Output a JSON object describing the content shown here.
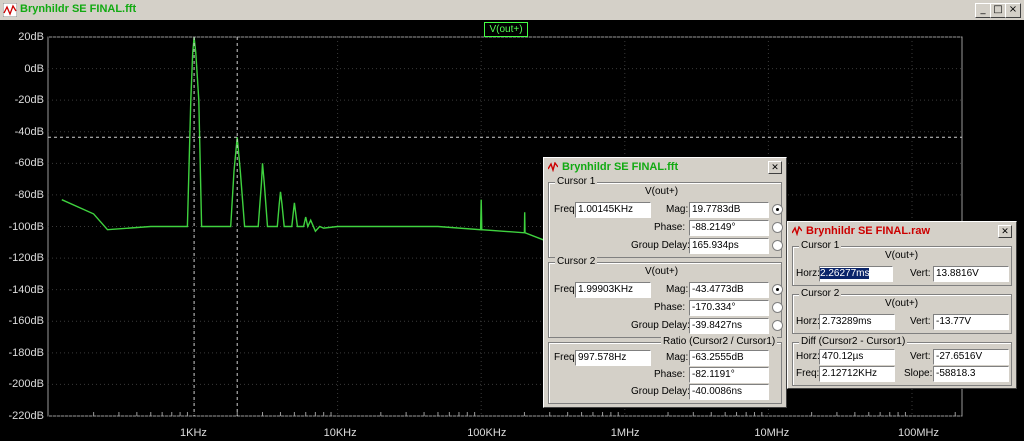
{
  "window": {
    "title": "Brynhildr SE FINAL.fft",
    "minimize": "_",
    "maximize": "□",
    "close": "×"
  },
  "trace_label": "V(out+)",
  "colors": {
    "trace": "#3fd23f",
    "grid": "#e0e0e0",
    "plot_bg": "#000000",
    "dialog_title_red": "#cc0000"
  },
  "chart_data": {
    "type": "line",
    "title": "",
    "xlabel": "",
    "ylabel": "",
    "x_scale": "log",
    "xlim": [
      100,
      300000
    ],
    "ylim": [
      -220,
      20
    ],
    "grid": "dotted",
    "y_ticks": [
      "20dB",
      "0dB",
      "-20dB",
      "-40dB",
      "-60dB",
      "-80dB",
      "-100dB",
      "-120dB",
      "-140dB",
      "-160dB",
      "-180dB",
      "-200dB",
      "-220dB"
    ],
    "x_ticks": [
      "1KHz",
      "10KHz",
      "100KHz",
      "1MHz",
      "10MHz",
      "100MHz"
    ],
    "series": [
      {
        "name": "V(out+)",
        "x": [
          120,
          200,
          250,
          500,
          900,
          950,
          980,
          1001,
          1030,
          1080,
          1130,
          1800,
          1900,
          2000,
          2100,
          2250,
          2800,
          2950,
          3000,
          3080,
          3250,
          3800,
          3920,
          4000,
          4100,
          4250,
          4800,
          4930,
          5000,
          5080,
          5250,
          5800,
          6000,
          6200,
          6500,
          7000,
          7500,
          8000,
          10000,
          20000,
          50000,
          99000,
          100000,
          101000,
          200000,
          201000,
          202000,
          300000
        ],
        "y": [
          -83,
          -92,
          -102,
          -100,
          -100,
          -20,
          10,
          19.78,
          10,
          -20,
          -100,
          -100,
          -65,
          -43.48,
          -65,
          -100,
          -100,
          -72,
          -60,
          -72,
          -100,
          -100,
          -86,
          -78,
          -86,
          -100,
          -100,
          -90,
          -85,
          -90,
          -100,
          -100,
          -94,
          -100,
          -96,
          -103,
          -100,
          -101,
          -100,
          -100,
          -100,
          -102,
          -83,
          -102,
          -104,
          -91,
          -104,
          -110
        ]
      }
    ],
    "cursors": [
      {
        "label": "Cursor 1",
        "freq_hz": 1001.45,
        "mag_db": 19.7783
      },
      {
        "label": "Cursor 2",
        "freq_hz": 1999.03,
        "mag_db": -43.4773
      }
    ]
  },
  "fft_dialog": {
    "title": "Brynhildr SE FINAL.fft",
    "cursor1": {
      "label": "Cursor 1",
      "trace": "V(out+)",
      "freq_label": "Freq:",
      "freq": "1.00145KHz",
      "mag_label": "Mag:",
      "mag": "19.7783dB",
      "phase_label": "Phase:",
      "phase": "-88.2149°",
      "gd_label": "Group Delay:",
      "gd": "165.934ps"
    },
    "cursor2": {
      "label": "Cursor 2",
      "trace": "V(out+)",
      "freq_label": "Freq:",
      "freq": "1.99903KHz",
      "mag_label": "Mag:",
      "mag": "-43.4773dB",
      "phase_label": "Phase:",
      "phase": "-170.334°",
      "gd_label": "Group Delay:",
      "gd": "-39.8427ns"
    },
    "ratio": {
      "label": "Ratio (Cursor2 / Cursor1)",
      "freq_label": "Freq:",
      "freq": "997.578Hz",
      "mag_label": "Mag:",
      "mag": "-63.2555dB",
      "phase_label": "Phase:",
      "phase": "-82.1191°",
      "gd_label": "Group Delay:",
      "gd": "-40.0086ns"
    }
  },
  "raw_dialog": {
    "title": "Brynhildr SE FINAL.raw",
    "cursor1": {
      "label": "Cursor 1",
      "trace": "V(out+)",
      "horz_label": "Horz:",
      "horz": "2.26277ms",
      "vert_label": "Vert:",
      "vert": "13.8816V"
    },
    "cursor2": {
      "label": "Cursor 2",
      "trace": "V(out+)",
      "horz_label": "Horz:",
      "horz": "2.73289ms",
      "vert_label": "Vert:",
      "vert": "-13.77V"
    },
    "diff": {
      "label": "Diff (Cursor2 - Cursor1)",
      "horz_label": "Horz:",
      "horz": "470.12µs",
      "vert_label": "Vert:",
      "vert": "-27.6516V",
      "freq_label": "Freq:",
      "freq": "2.12712KHz",
      "slope_label": "Slope:",
      "slope": "-58818.3"
    }
  }
}
